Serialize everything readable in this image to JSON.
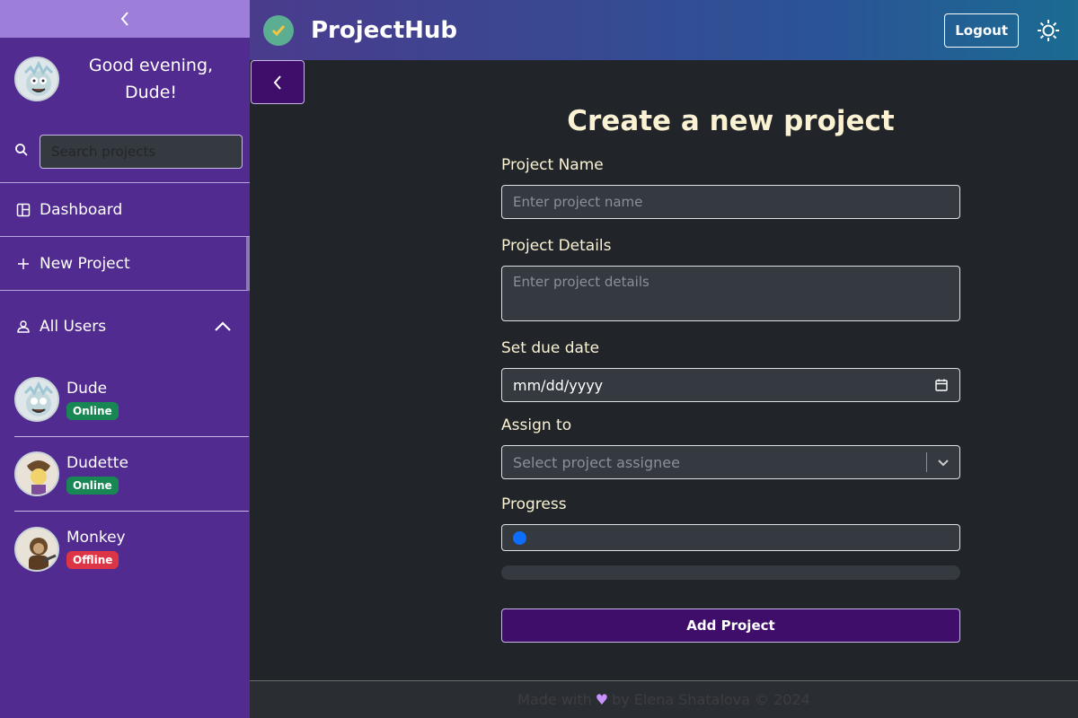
{
  "app": {
    "title": "ProjectHub"
  },
  "header": {
    "logout_label": "Logout",
    "theme_icon": "sun-icon"
  },
  "sidebar": {
    "greeting": "Good evening, Dude!",
    "search_placeholder": "Search projects",
    "nav": [
      {
        "label": "Dashboard",
        "icon": "dashboard-icon"
      },
      {
        "label": "New Project",
        "icon": "plus-icon"
      }
    ],
    "users_heading": "All Users",
    "users": [
      {
        "name": "Dude",
        "status": "Online"
      },
      {
        "name": "Dudette",
        "status": "Online"
      },
      {
        "name": "Monkey",
        "status": "Offline"
      }
    ]
  },
  "form": {
    "title": "Create a new project",
    "project_name_label": "Project Name",
    "project_name_placeholder": "Enter project name",
    "project_details_label": "Project Details",
    "project_details_placeholder": "Enter project details",
    "due_date_label": "Set due date",
    "due_date_value": "mm/dd/yyyy",
    "assign_label": "Assign to",
    "assign_placeholder": "Select project assignee",
    "progress_label": "Progress",
    "progress_value": 0,
    "submit_label": "Add Project"
  },
  "footer": {
    "made_with": "Made with",
    "by": "by Elena Shatalova © 2024"
  },
  "colors": {
    "sidebar": "#512b8f",
    "accent": "#3f0e6a",
    "title": "#fbf2d3",
    "online": "#198754",
    "offline": "#dc3545"
  }
}
